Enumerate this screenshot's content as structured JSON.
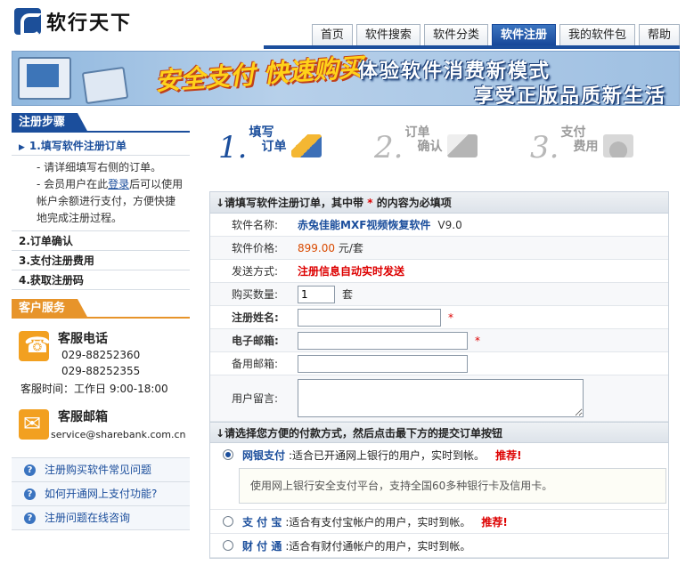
{
  "site": {
    "logo_text": "软行天下"
  },
  "nav": {
    "tabs": [
      {
        "label": "首页",
        "active": false
      },
      {
        "label": "软件搜索",
        "active": false
      },
      {
        "label": "软件分类",
        "active": false
      },
      {
        "label": "软件注册",
        "active": true
      },
      {
        "label": "我的软件包",
        "active": false
      },
      {
        "label": "帮助",
        "active": false
      }
    ]
  },
  "banner": {
    "slogan": "安全支付 快速购买",
    "line1": "体验软件消费新模式",
    "line2": "享受正版品质新生活"
  },
  "sidebar": {
    "steps_title": "注册步骤",
    "steps": [
      {
        "label": "1.填写软件注册订单"
      },
      {
        "label": "2.订单确认"
      },
      {
        "label": "3.支付注册费用"
      },
      {
        "label": "4.获取注册码"
      }
    ],
    "desc1": "- 请详细填写右侧的订单。",
    "desc2_pre": "- 会员用户在此",
    "desc2_link": "登录",
    "desc2_post": "后可以使用帐户余额进行支付，方便快捷地完成注册过程。",
    "service_title": "客户服务",
    "phone_title": "客服电话",
    "phone1": "029-88252360",
    "phone2": "029-88252355",
    "hours": "客服时间：工作日 9:00-18:00",
    "email_title": "客服邮箱",
    "email": "service@sharebank.com.cn",
    "faq": [
      {
        "label": "注册购买软件常见问题"
      },
      {
        "label": "如何开通网上支付功能?"
      },
      {
        "label": "注册问题在线咨询"
      }
    ]
  },
  "process": [
    {
      "num": "1.",
      "top": "填写",
      "bottom": "订单"
    },
    {
      "num": "2.",
      "top": "订单",
      "bottom": "确认"
    },
    {
      "num": "3.",
      "top": "支付",
      "bottom": "费用"
    }
  ],
  "form": {
    "header_pre": "↓请填写软件注册订单，其中带",
    "header_star": "*",
    "header_post": "的内容为必填项",
    "software_name_label": "软件名称:",
    "software_name": "赤兔佳能MXF视频恢复软件",
    "software_version": "V9.0",
    "price_label": "软件价格:",
    "price": "899.00",
    "price_unit": "元/套",
    "delivery_label": "发送方式:",
    "delivery": "注册信息自动实时发送",
    "qty_label": "购买数量:",
    "qty_value": "1",
    "qty_unit": "套",
    "name_label": "注册姓名:",
    "email_label": "电子邮箱:",
    "backup_email_label": "备用邮箱:",
    "message_label": "用户留言:",
    "required_star": "*"
  },
  "payment": {
    "header": "↓请选择您方便的付款方式，然后点击最下方的提交订单按钮",
    "options": [
      {
        "name": "网银支付",
        "desc": ":适合已开通网上银行的用户，实时到帐。",
        "rec": "推荐!",
        "selected": true
      },
      {
        "name": "支 付 宝",
        "desc": ":适合有支付宝帐户的用户，实时到帐。",
        "rec": "推荐!",
        "selected": false
      },
      {
        "name": "财 付 通",
        "desc": ":适合有财付通帐户的用户，实时到帐。",
        "rec": "",
        "selected": false
      }
    ],
    "note": "使用网上银行安全支付平台，支持全国60多种银行卡及信用卡。"
  },
  "colors": {
    "brand": "#1b4e9c",
    "accent": "#e7942a",
    "required": "#d00"
  }
}
